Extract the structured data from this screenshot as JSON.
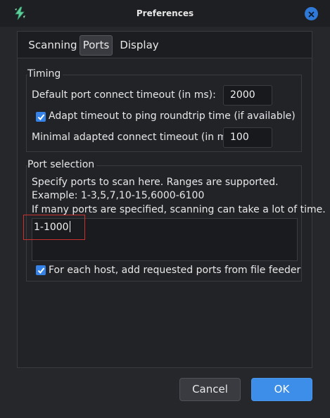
{
  "window": {
    "title": "Preferences"
  },
  "tabs": [
    {
      "label": "Scanning",
      "active": false
    },
    {
      "label": "Ports",
      "active": true
    },
    {
      "label": "Display",
      "active": false
    }
  ],
  "timing": {
    "group_label": "Timing",
    "default_timeout_label": "Default port connect timeout (in ms):",
    "default_timeout_value": "2000",
    "adapt_label": "Adapt timeout to ping roundtrip time (if available)",
    "adapt_checked": true,
    "min_timeout_label": "Minimal adapted connect timeout (in ms):",
    "min_timeout_value": "100"
  },
  "port_selection": {
    "group_label": "Port selection",
    "help_line1": "Specify ports to scan here. Ranges are supported.",
    "help_line2": "Example: 1-3,5,7,10-15,6000-6100",
    "help_line3": "If many ports are specified, scanning can take a lot of time.",
    "ports_value": "1-1000",
    "file_feeder_label": "For each host, add requested ports from file feeder",
    "file_feeder_checked": true
  },
  "buttons": {
    "cancel": "Cancel",
    "ok": "OK"
  },
  "colors": {
    "accent": "#3d8ee8",
    "highlight": "#c8322f",
    "checkbox": "#3583e8"
  },
  "icons": {
    "app": "ipscan-lightning-icon",
    "close": "close-icon",
    "check": "checkmark-icon"
  }
}
